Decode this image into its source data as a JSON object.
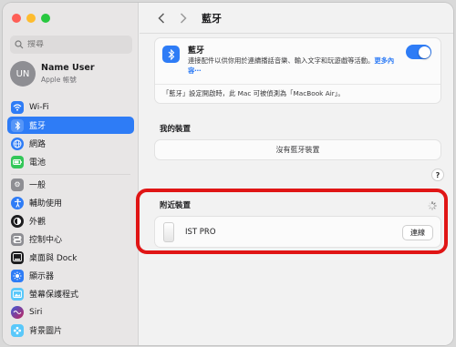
{
  "sidebar": {
    "search_placeholder": "搜尋",
    "user": {
      "initials": "UN",
      "name": "Name User",
      "subtitle": "Apple 帳號"
    },
    "group1": [
      {
        "label": "Wi-Fi",
        "icon": "wifi-icon",
        "color": "#2e7cf6",
        "active": false
      },
      {
        "label": "藍牙",
        "icon": "bluetooth-icon",
        "color": "#2e7cf6",
        "active": true
      },
      {
        "label": "網路",
        "icon": "globe-icon",
        "color": "#2e7cf6",
        "active": false
      },
      {
        "label": "電池",
        "icon": "battery-icon",
        "color": "#34c759",
        "active": false
      }
    ],
    "group2": [
      {
        "label": "一般",
        "icon": "gear-icon",
        "color": "#8e8e93"
      },
      {
        "label": "輔助使用",
        "icon": "accessibility-icon",
        "color": "#2e7cf6"
      },
      {
        "label": "外觀",
        "icon": "appearance-icon",
        "color": "#1d1d1f"
      },
      {
        "label": "控制中心",
        "icon": "control-center-icon",
        "color": "#8e8e93"
      },
      {
        "label": "桌面與 Dock",
        "icon": "dock-icon",
        "color": "#1d1d1f"
      },
      {
        "label": "顯示器",
        "icon": "display-icon",
        "color": "#2e7cf6"
      },
      {
        "label": "螢幕保護程式",
        "icon": "screensaver-icon",
        "color": "#5ac8fa"
      },
      {
        "label": "Siri",
        "icon": "siri-icon",
        "color": "#6b3fa0"
      },
      {
        "label": "背景圖片",
        "icon": "wallpaper-icon",
        "color": "#5ac8fa"
      }
    ]
  },
  "header": {
    "title": "藍牙"
  },
  "bluetooth": {
    "title": "藍牙",
    "description": "連接配件以供你用於連續播話音樂、輸入文字和玩遊戲等活動。",
    "more_link": "更多內容⋯",
    "enabled": true,
    "note": "「藍牙」設定開啟時，此 Mac 可被偵測為「MacBook Air」。"
  },
  "my_devices": {
    "label": "我的裝置",
    "empty_text": "沒有藍牙裝置"
  },
  "help_label": "?",
  "nearby": {
    "label": "附近裝置",
    "devices": [
      {
        "name": "IST PRO",
        "action": "連線"
      }
    ]
  },
  "colors": {
    "accent": "#2e7cf6",
    "highlight": "#e01515"
  }
}
